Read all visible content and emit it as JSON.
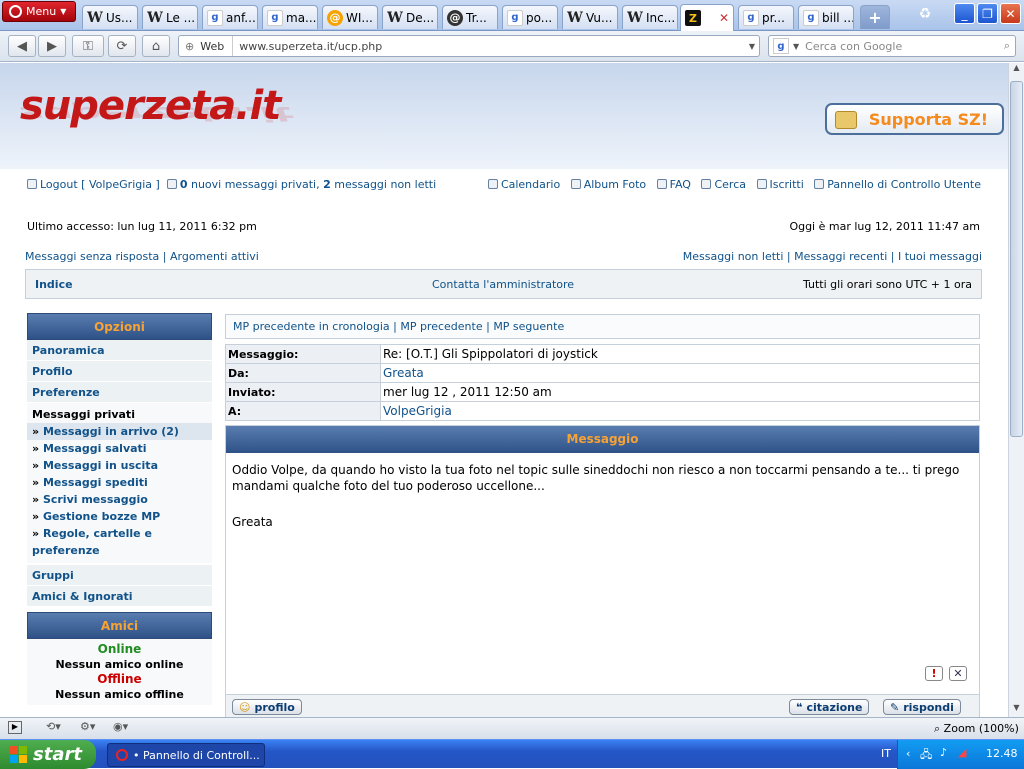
{
  "browser": {
    "menu_label": "Menu",
    "tabs": [
      {
        "icon": "wikipedia-icon",
        "glyph": "W",
        "label": "Us...",
        "kind": "w"
      },
      {
        "icon": "wikipedia-icon",
        "glyph": "W",
        "label": "Le ...",
        "kind": "w"
      },
      {
        "icon": "google-icon",
        "glyph": "g",
        "label": "anf...",
        "kind": "g"
      },
      {
        "icon": "google-icon",
        "glyph": "g",
        "label": "ma...",
        "kind": "g"
      },
      {
        "icon": "cooking-icon",
        "glyph": "@",
        "label": "WI...",
        "kind": "c"
      },
      {
        "icon": "wikipedia-icon",
        "glyph": "W",
        "label": "De...",
        "kind": "w"
      },
      {
        "icon": "tr-site-icon",
        "glyph": "@",
        "label": "Tr...",
        "kind": "t"
      },
      {
        "icon": "google-icon",
        "glyph": "g",
        "label": "po...",
        "kind": "g"
      },
      {
        "icon": "wikipedia-icon",
        "glyph": "W",
        "label": "Vu...",
        "kind": "w"
      },
      {
        "icon": "wikipedia-icon",
        "glyph": "W",
        "label": "Inc...",
        "kind": "w"
      },
      {
        "icon": "superzeta-icon",
        "glyph": "Z",
        "label": "",
        "kind": "z"
      },
      {
        "icon": "google-icon",
        "glyph": "g",
        "label": "pr...",
        "kind": "g"
      },
      {
        "icon": "google-icon",
        "glyph": "g",
        "label": "bill ...",
        "kind": "g"
      }
    ],
    "address": {
      "scheme_label": "Web",
      "url": "www.superzeta.it/ucp.php"
    },
    "search_placeholder": "Cerca con Google",
    "zoom": "Zoom (100%)"
  },
  "site": {
    "logo_text": "superzeta.it",
    "support_button": "Supporta SZ!",
    "topbar": {
      "logout": "Logout [ VolpeGrigia ]",
      "pm_count": "0",
      "pm_new_text": "nuovi messaggi privati,",
      "pm_unread_count": "2",
      "pm_unread_text": "messaggi non letti",
      "calendar": "Calendario",
      "album": "Album Foto",
      "faq": "FAQ",
      "search": "Cerca",
      "members": "Iscritti",
      "ucp": "Pannello di Controllo Utente"
    },
    "last_visit": "Ultimo accesso: lun lug 11, 2011 6:32 pm",
    "current_time": "Oggi è mar lug 12, 2011 11:47 am",
    "links_left": [
      "Messaggi senza risposta",
      "Argomenti attivi"
    ],
    "links_right": [
      "Messaggi non letti",
      "Messaggi recenti",
      "I tuoi messaggi"
    ],
    "navbar": {
      "index": "Indice",
      "contact": "Contatta l'amministratore",
      "timezone": "Tutti gli orari sono UTC + 1 ora"
    }
  },
  "sidebar": {
    "options_title": "Opzioni",
    "items_top": [
      "Panoramica",
      "Profilo",
      "Preferenze"
    ],
    "pm_header": "Messaggi privati",
    "pm_items": [
      {
        "label": "Messaggi in arrivo (2)",
        "selected": true
      },
      {
        "label": "Messaggi salvati",
        "selected": false
      },
      {
        "label": "Messaggi in uscita",
        "selected": false
      },
      {
        "label": "Messaggi spediti",
        "selected": false
      },
      {
        "label": "Scrivi messaggio",
        "selected": false
      },
      {
        "label": "Gestione bozze MP",
        "selected": false
      },
      {
        "label": "Regole, cartelle e preferenze",
        "selected": false
      }
    ],
    "items_bottom": [
      "Gruppi",
      "Amici & Ignorati"
    ],
    "friends_title": "Amici",
    "online_label": "Online",
    "online_none": "Nessun amico online",
    "offline_label": "Offline",
    "offline_none": "Nessun amico offline"
  },
  "message": {
    "nav": [
      "MP precedente in cronologia",
      "MP precedente",
      "MP seguente"
    ],
    "fields": [
      {
        "key": "Messaggio:",
        "value": "Re: [O.T.] Gli Spippolatori di joystick",
        "link": false
      },
      {
        "key": "Da:",
        "value": "Greata",
        "link": true
      },
      {
        "key": "Inviato:",
        "value": "mer lug 12 , 2011 12:50 am",
        "link": false
      },
      {
        "key": "A:",
        "value": "VolpeGrigia",
        "link": true
      }
    ],
    "box_title": "Messaggio",
    "body": "Oddio Volpe, da quando ho visto la tua foto nel topic sulle sineddochi non riesco a non toccarmi pensando a te... ti prego mandami qualche foto del tuo poderoso uccellone...",
    "signature": "Greata",
    "profile_button": "profilo",
    "quote_button": "citazione",
    "reply_button": "rispondi"
  },
  "taskbar": {
    "start": "start",
    "item": "• Pannello di Controll...",
    "lang": "IT",
    "clock": "12.48"
  },
  "colors": {
    "accent_orange": "#f7a234",
    "link_blue": "#105289",
    "logo_red": "#c41818",
    "online_green": "#218c21",
    "offline_red": "#cc0000"
  }
}
